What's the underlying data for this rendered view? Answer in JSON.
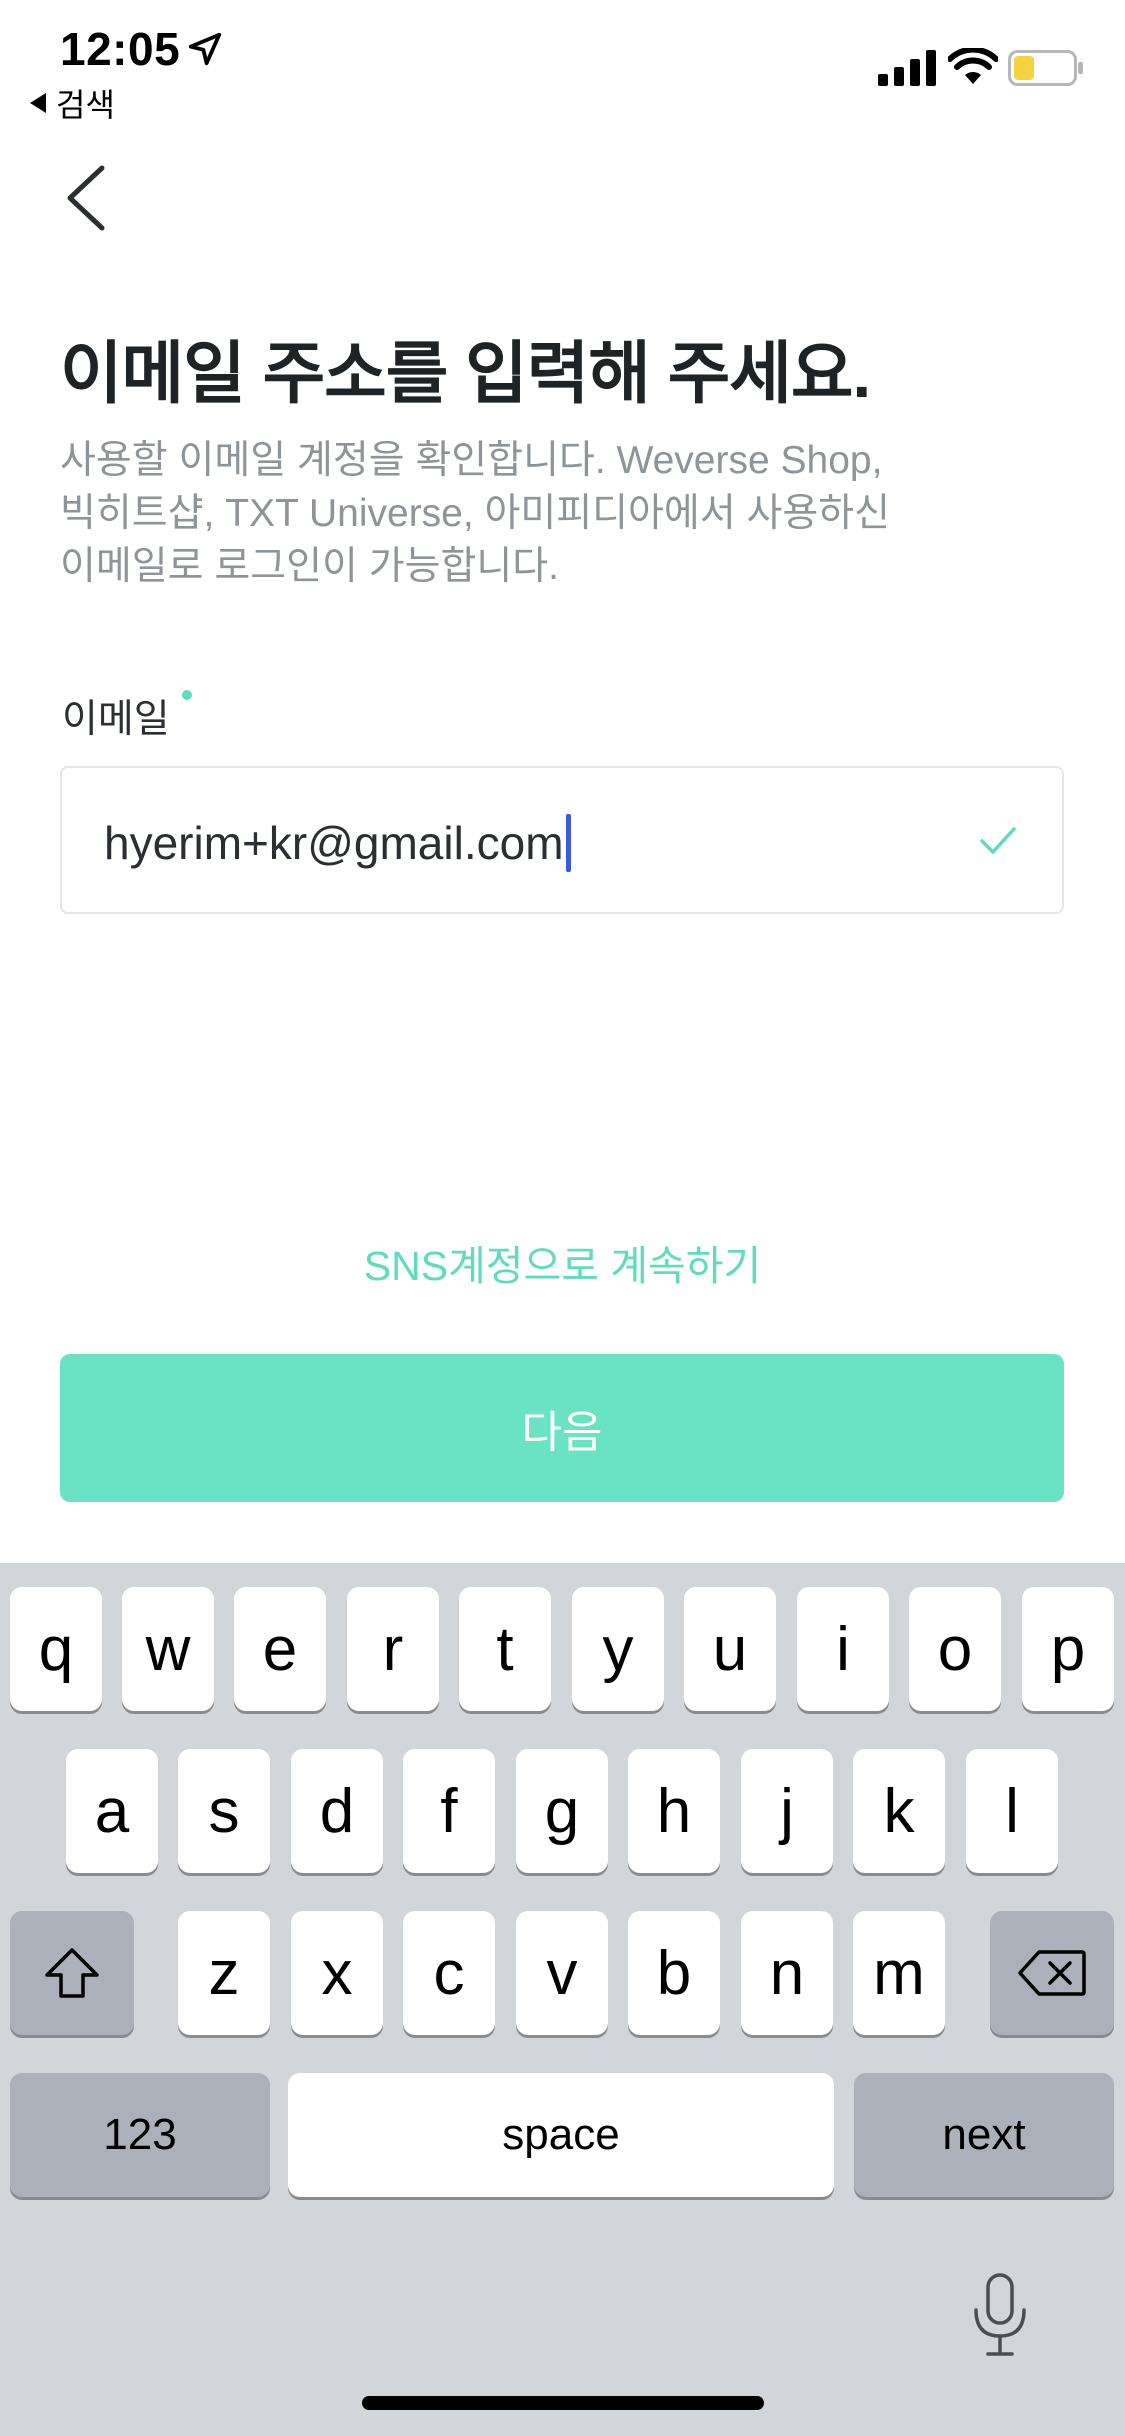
{
  "status_bar": {
    "time": "12:05",
    "back_app": "검색"
  },
  "icons": {
    "location": "location-arrow-icon",
    "signal": "cellular-signal-icon",
    "wifi": "wifi-icon",
    "battery": "battery-icon",
    "back": "chevron-left-icon",
    "check": "checkmark-icon",
    "shift": "shift-icon",
    "delete": "delete-icon",
    "mic": "microphone-icon"
  },
  "page": {
    "title": "이메일 주소를 입력해 주세요.",
    "description_lines": [
      "사용할 이메일 계정을 확인합니다. Weverse Shop,",
      "빅히트샵, TXT Universe, 아미피디아에서 사용하신",
      "이메일로 로그인이 가능합니다."
    ]
  },
  "email_field": {
    "label": "이메일",
    "value": "hyerim+kr@gmail.com"
  },
  "sns_link": "SNS계정으로 계속하기",
  "next_button": "다음",
  "keyboard": {
    "row1": [
      "q",
      "w",
      "e",
      "r",
      "t",
      "y",
      "u",
      "i",
      "o",
      "p"
    ],
    "row2": [
      "a",
      "s",
      "d",
      "f",
      "g",
      "h",
      "j",
      "k",
      "l"
    ],
    "row3": [
      "z",
      "x",
      "c",
      "v",
      "b",
      "n",
      "m"
    ],
    "numbers_key": "123",
    "space_key": "space",
    "return_key": "next"
  },
  "colors": {
    "accent": "#5fdcbd",
    "button": "#6ae3c5",
    "caret": "#3a5ad9",
    "battery_fill": "#f5d33f"
  }
}
